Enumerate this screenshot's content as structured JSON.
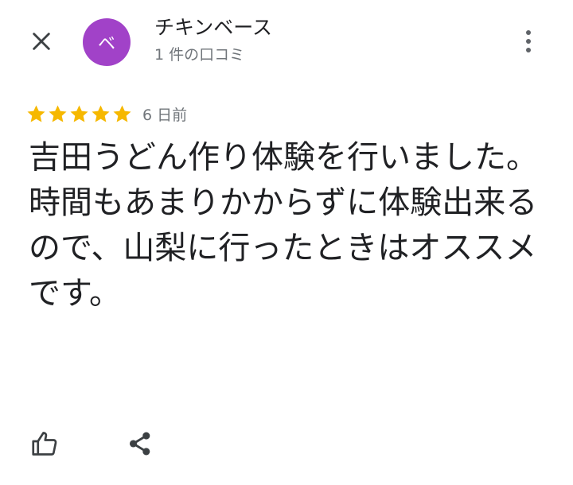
{
  "header": {
    "close_icon": "close-icon",
    "more_icon": "more-vert-icon"
  },
  "reviewer": {
    "avatar_initial": "ベ",
    "avatar_color": "#a142c8",
    "name": "チキンベース",
    "review_count": "1 件の口コミ"
  },
  "review": {
    "rating": 5,
    "rating_max": 5,
    "star_color": "#f6b800",
    "date": "6 日前",
    "text": "吉田うどん作り体験を行いました。\n時間もあまりかからずに体験出来るので、山梨に行ったときはオススメです。"
  },
  "actions": {
    "like_icon": "thumb-up-icon",
    "share_icon": "share-icon"
  }
}
